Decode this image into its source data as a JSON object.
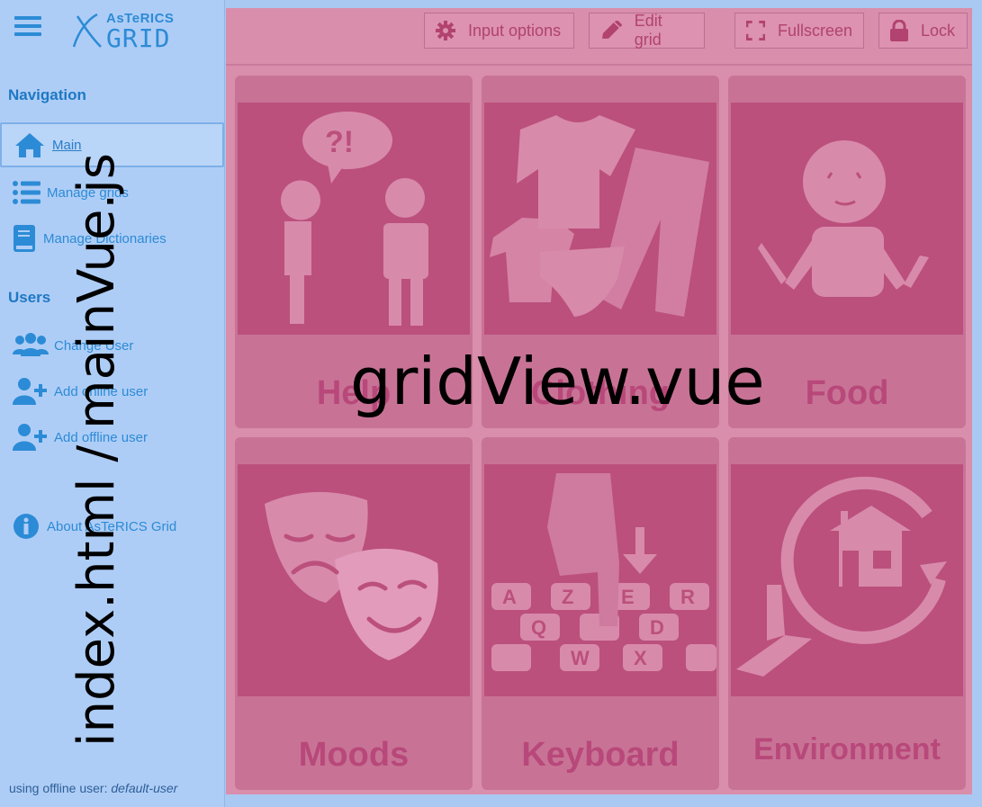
{
  "app": {
    "logo_top": "AsTeRICS",
    "logo_bottom": "GRID"
  },
  "sidebar": {
    "nav_title": "Navigation",
    "nav_items": [
      {
        "label": "Main",
        "icon": "home-icon",
        "active": true
      },
      {
        "label": "Manage grids",
        "icon": "list-icon"
      },
      {
        "label": "Manage Dictionaries",
        "icon": "book-icon"
      }
    ],
    "users_title": "Users",
    "user_items": [
      {
        "label": "Change User",
        "icon": "users-icon"
      },
      {
        "label": "Add online user",
        "icon": "user-plus-icon"
      },
      {
        "label": "Add offline user",
        "icon": "user-plus-icon"
      }
    ],
    "about": {
      "label": "About AsTeRICS Grid",
      "icon": "info-icon"
    },
    "footer_prefix": "using offline user:",
    "footer_user": "default-user"
  },
  "toolbar": {
    "buttons": [
      {
        "label": "Input options",
        "icon": "gear-icon"
      },
      {
        "label": "Edit grid",
        "icon": "pencil-icon"
      },
      {
        "label": "Fullscreen",
        "icon": "fullscreen-icon"
      },
      {
        "label": "Lock",
        "icon": "lock-icon"
      }
    ]
  },
  "grid": {
    "cells": [
      {
        "label": "Help",
        "icon": "help-pictogram"
      },
      {
        "label": "Clothing",
        "icon": "clothing-pictogram"
      },
      {
        "label": "Food",
        "icon": "food-pictogram"
      },
      {
        "label": "Moods",
        "icon": "moods-pictogram"
      },
      {
        "label": "Keyboard",
        "icon": "keyboard-pictogram"
      },
      {
        "label": "Environment",
        "icon": "environment-pictogram"
      }
    ]
  },
  "overlay": {
    "vertical_label": "index.html / mainVue.js",
    "center_label": "gridView.vue"
  },
  "colors": {
    "sidebar_bg": "#aecdf6",
    "accent": "#2c8bd6",
    "main_overlay": "#d98eac",
    "cell_bg": "#c87396",
    "pictogram_bg": "#bb507c"
  }
}
